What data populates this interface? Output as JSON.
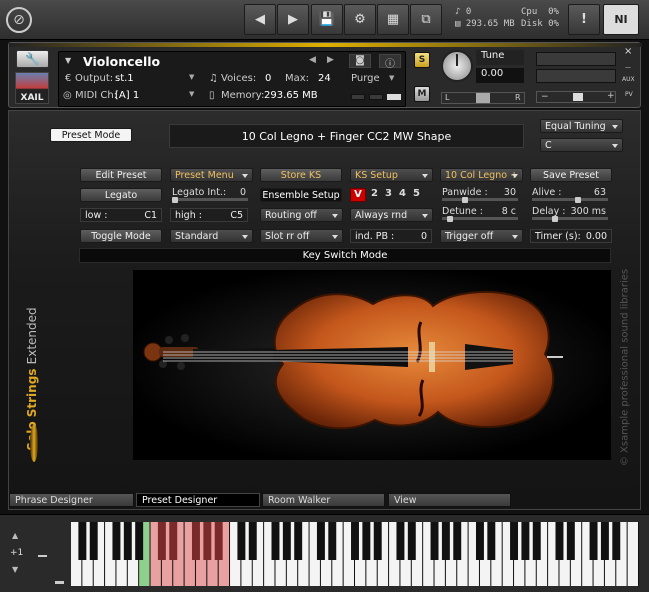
{
  "top": {
    "cpu_label": "Cpu",
    "cpu_val": "0%",
    "disk_label": "Disk",
    "disk_val": "0%",
    "voices": "0",
    "memory": "293.65 MB",
    "alert": "!",
    "ni_logo": "NI"
  },
  "instrument": {
    "name": "Violoncello",
    "output_label": "Output:",
    "output_value": "st.1",
    "voices_label": "Voices:",
    "voices_value": "0",
    "max_label": "Max:",
    "max_value": "24",
    "purge_label": "Purge",
    "midi_label": "MIDI Ch:",
    "midi_value": "[A]  1",
    "memory_label": "Memory:",
    "memory_value": "293.65 MB",
    "tune_label": "Tune",
    "tune_value": "0.00",
    "s_label": "S",
    "m_label": "M",
    "pan_l": "L",
    "pan_r": "R",
    "aux": "AUX",
    "pv": "PV",
    "brand": "XAIL"
  },
  "controls": {
    "preset_mode": "Preset Mode",
    "preset_title": "10 Col Legno + Finger CC2 MW Shape",
    "tuning": "Equal Tuning",
    "key": "C",
    "edit_preset": "Edit Preset",
    "preset_menu": "Preset Menu",
    "store_ks": "Store KS",
    "ks_setup": "KS Setup",
    "current_preset": "10 Col Legno + Fing",
    "save_preset": "Save Preset",
    "legato": "Legato",
    "legato_int_label": "Legato Int.:",
    "legato_int_value": "0",
    "ensemble_setup": "Ensemble Setup",
    "v_label": "V",
    "ks_nums": [
      "2",
      "3",
      "4",
      "5"
    ],
    "panwide_label": "Panwide :",
    "panwide_value": "30",
    "alive_label": "Alive :",
    "alive_value": "63",
    "low_label": "low :",
    "low_value": "C1",
    "high_label": "high :",
    "high_value": "C5",
    "routing": "Routing off",
    "always_rnd": "Always rnd",
    "detune_label": "Detune :",
    "detune_value": "8 c",
    "delay_label": "Delay :",
    "delay_value": "300 ms",
    "toggle_mode": "Toggle Mode",
    "standard": "Standard",
    "slot_rr": "Slot rr off",
    "ind_pb_label": "ind. PB :",
    "ind_pb_value": "0",
    "trigger": "Trigger off",
    "timer_label": "Timer (s):",
    "timer_value": "0.00",
    "key_switch_mode": "Key Switch Mode",
    "alive_level": 0.63,
    "panwide_level": 0.3,
    "legato_level": 0.0,
    "detune_level": 0.08,
    "delay_level": 0.3
  },
  "branding": {
    "side_title_a": "Solo Strings",
    "side_title_b": "Extended",
    "copyright": "© Xsample professional sound libraries"
  },
  "tabs": [
    "Phrase Designer",
    "Preset Designer",
    "Room Walker",
    "View"
  ],
  "active_tab": "Preset Designer",
  "keyboard": {
    "octave_label": "+1"
  }
}
